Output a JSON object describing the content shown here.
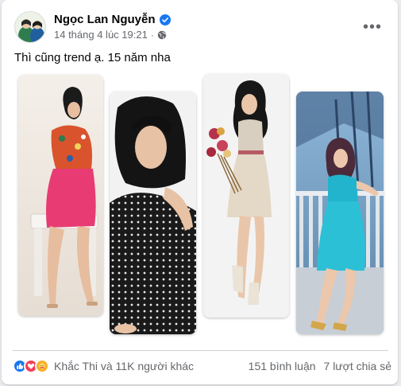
{
  "post": {
    "author": "Ngọc Lan Nguyễn",
    "timestamp": "14 tháng 4 lúc 19:21",
    "separator": "·",
    "caption": "Thì cũng trend ạ. 15 năm nha"
  },
  "engagement": {
    "reactions_text": "Khắc Thi và 11K người khác",
    "comments": "151 bình luận",
    "shares": "7 lượt chia sẻ"
  },
  "icons": {
    "verified": "verified-badge-icon",
    "privacy": "globe-icon",
    "more": "more-options-icon",
    "reaction_like": "like-reaction-icon",
    "reaction_love": "love-reaction-icon",
    "reaction_care": "care-reaction-icon"
  },
  "colors": {
    "brand_blue": "#1877f2",
    "love_red": "#f33e58",
    "care_yellow": "#f7b125",
    "secondary_text": "#65676b",
    "primary_text": "#050505"
  }
}
